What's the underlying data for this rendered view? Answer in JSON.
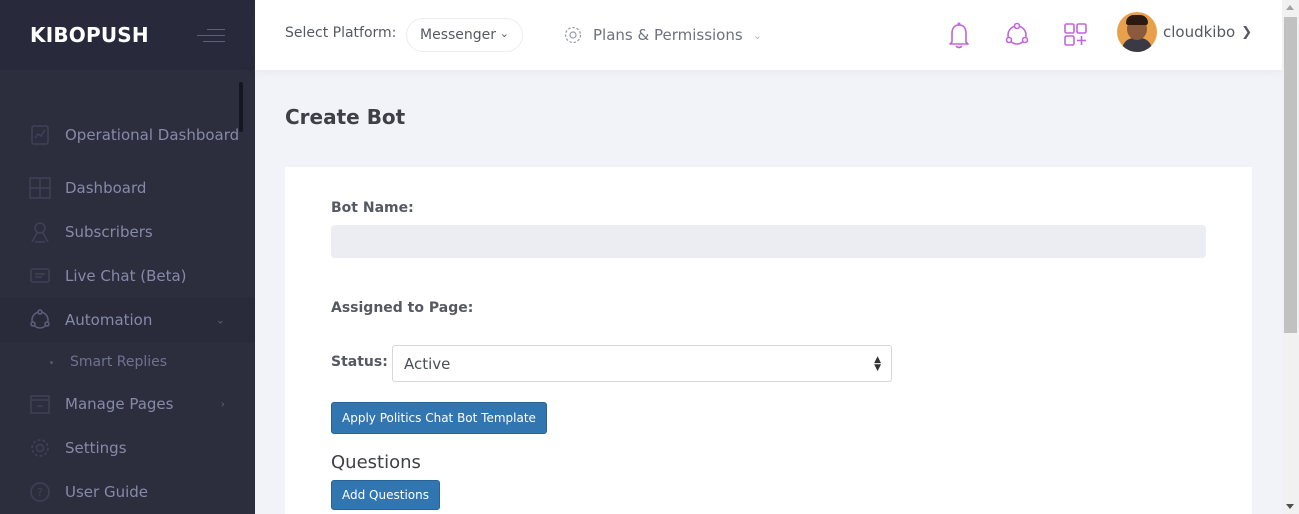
{
  "sidebar": {
    "brand": "KIBOPUSH",
    "items": [
      {
        "label": "Operational Dashboard",
        "icon": "chart-icon"
      },
      {
        "label": "Dashboard",
        "icon": "dashboard-icon"
      },
      {
        "label": "Subscribers",
        "icon": "subscribers-icon"
      },
      {
        "label": "Live Chat (Beta)",
        "icon": "chat-icon"
      },
      {
        "label": "Automation",
        "icon": "automation-icon"
      },
      {
        "label": "Manage Pages",
        "icon": "pages-icon"
      },
      {
        "label": "Settings",
        "icon": "settings-icon"
      },
      {
        "label": "User Guide",
        "icon": "help-icon"
      }
    ],
    "sub_items": [
      {
        "label": "Smart Replies"
      }
    ]
  },
  "header": {
    "platform_label": "Select Platform:",
    "platform_value": "Messenger",
    "plans_label": "Plans & Permissions",
    "user_name": "cloudkibo"
  },
  "main": {
    "page_title": "Create Bot",
    "bot_name_label": "Bot Name:",
    "bot_name_value": "",
    "assigned_page_label": "Assigned to Page:",
    "status_label": "Status:",
    "status_value": "Active",
    "template_button": "Apply Politics Chat Bot Template",
    "questions_title": "Questions",
    "add_questions_button": "Add Questions"
  },
  "colors": {
    "sidebar_bg": "#2c2e3e",
    "accent_purple": "#c066d8",
    "button_blue": "#3276b1"
  }
}
